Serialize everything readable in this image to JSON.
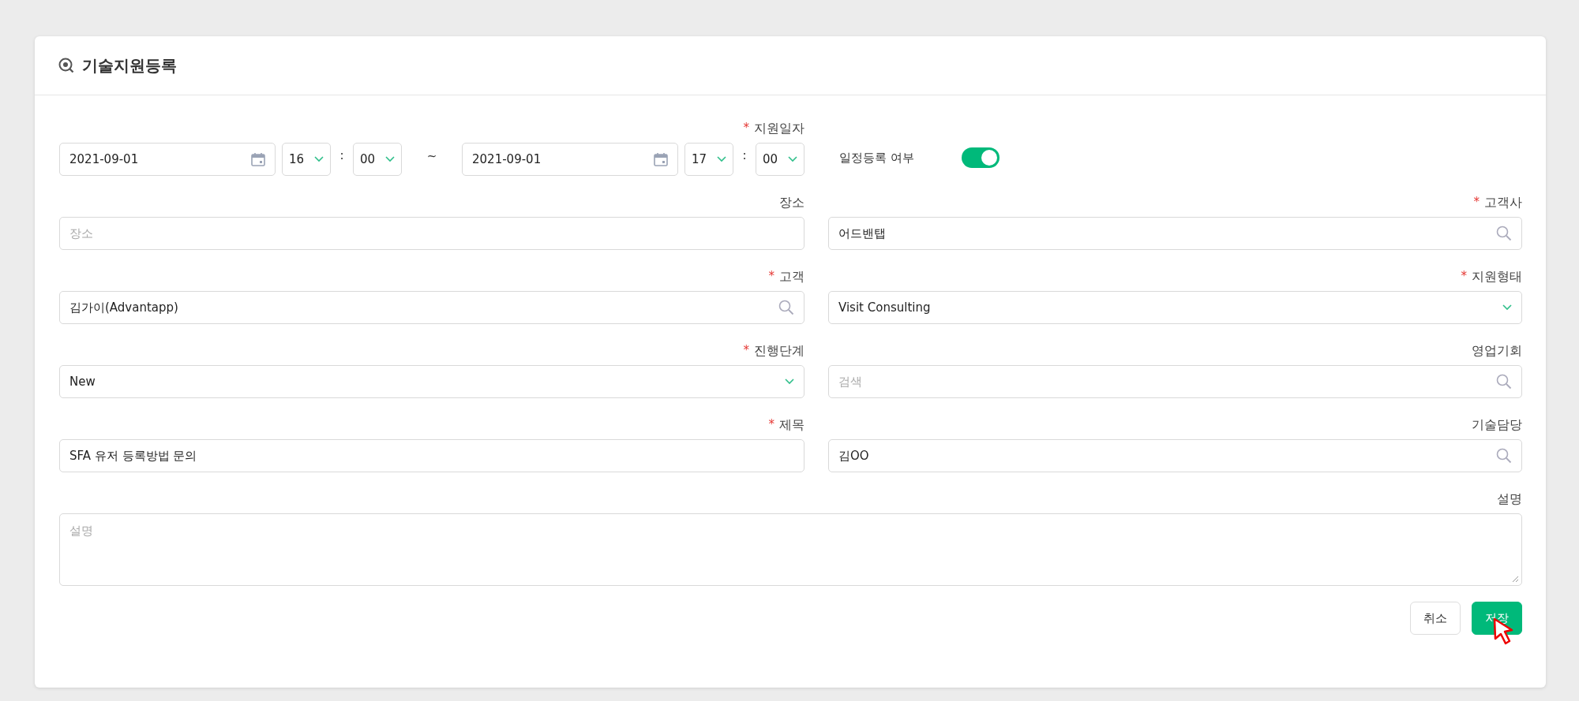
{
  "title": "기술지원등록",
  "support_date": {
    "label": "지원일자",
    "required_mark": "*",
    "start_date": "2021-09-01",
    "start_hour": "16",
    "start_colon": ":",
    "start_minute": "00",
    "separator": "~",
    "end_date": "2021-09-01",
    "end_hour": "17",
    "end_colon": ":",
    "end_minute": "00"
  },
  "schedule_toggle": {
    "label": "일정등록 여부",
    "on": true
  },
  "fields": [
    {
      "kind": "text",
      "label": "장소",
      "placeholder": "장소"
    },
    {
      "kind": "search",
      "label": "고객사",
      "required_mark": "*",
      "value": "어드밴탭"
    },
    {
      "kind": "search",
      "label": "고객",
      "required_mark": "*",
      "value": "김가이(Advantapp)"
    },
    {
      "kind": "select",
      "label": "지원형태",
      "required_mark": "*",
      "value": "Visit Consulting"
    },
    {
      "kind": "select",
      "label": "진행단계",
      "required_mark": "*",
      "value": "New"
    },
    {
      "kind": "search",
      "label": "영업기회",
      "placeholder": "검색"
    },
    {
      "kind": "text",
      "label": "제목",
      "required_mark": "*",
      "value": "SFA 유저 등록방법 문의"
    },
    {
      "kind": "search",
      "label": "기술담당",
      "value": "김OO"
    }
  ],
  "description": {
    "label": "설명",
    "placeholder": "설명"
  },
  "buttons": [
    {
      "kind": "secondary",
      "label": "취소"
    },
    {
      "kind": "primary",
      "label": "저장"
    }
  ]
}
